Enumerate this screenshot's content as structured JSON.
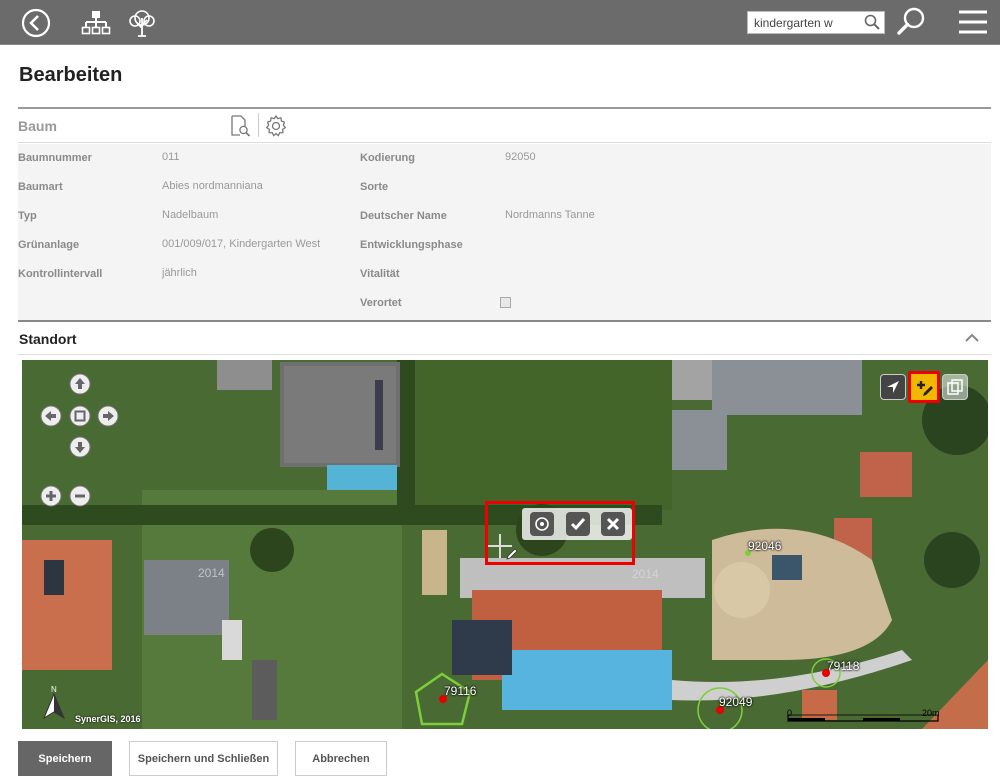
{
  "topbar": {
    "search_value": "kindergarten w"
  },
  "page": {
    "title": "Bearbeiten"
  },
  "baum": {
    "title": "Baum",
    "fields": {
      "baumnummer": {
        "label": "Baumnummer",
        "value": "011"
      },
      "baumart": {
        "label": "Baumart",
        "value": "Abies nordmanniana"
      },
      "typ": {
        "label": "Typ",
        "value": "Nadelbaum"
      },
      "gruenanlage": {
        "label": "Grünanlage",
        "value": "001/009/017, Kindergarten West"
      },
      "kontrollintervall": {
        "label": "Kontrollintervall",
        "value": "jährlich"
      },
      "kodierung": {
        "label": "Kodierung",
        "value": "92050"
      },
      "sorte": {
        "label": "Sorte",
        "value": ""
      },
      "deutscher_name": {
        "label": "Deutscher Name",
        "value": "Nordmanns Tanne"
      },
      "entwicklungsphase": {
        "label": "Entwicklungsphase",
        "value": ""
      },
      "vitalitaet": {
        "label": "Vitalität",
        "value": ""
      },
      "verortet": {
        "label": "Verortet",
        "checked": false
      }
    }
  },
  "standort": {
    "title": "Standort",
    "map": {
      "tree_markers": [
        "92046",
        "79118",
        "79116",
        "92049"
      ],
      "copyright": "SynerGIS, 2016",
      "scale": {
        "start": "0",
        "end": "20m"
      },
      "house_numbers": [
        "2014",
        "2014"
      ]
    }
  },
  "buttons": {
    "save": "Speichern",
    "save_close": "Speichern und Schließen",
    "cancel": "Abbrechen"
  },
  "colors": {
    "topbar": "#6b6b6b",
    "accent_tool": "#f2b800",
    "highlight": "#ee0000",
    "marker_red": "#e60000",
    "marker_green": "#7ccf3a"
  }
}
